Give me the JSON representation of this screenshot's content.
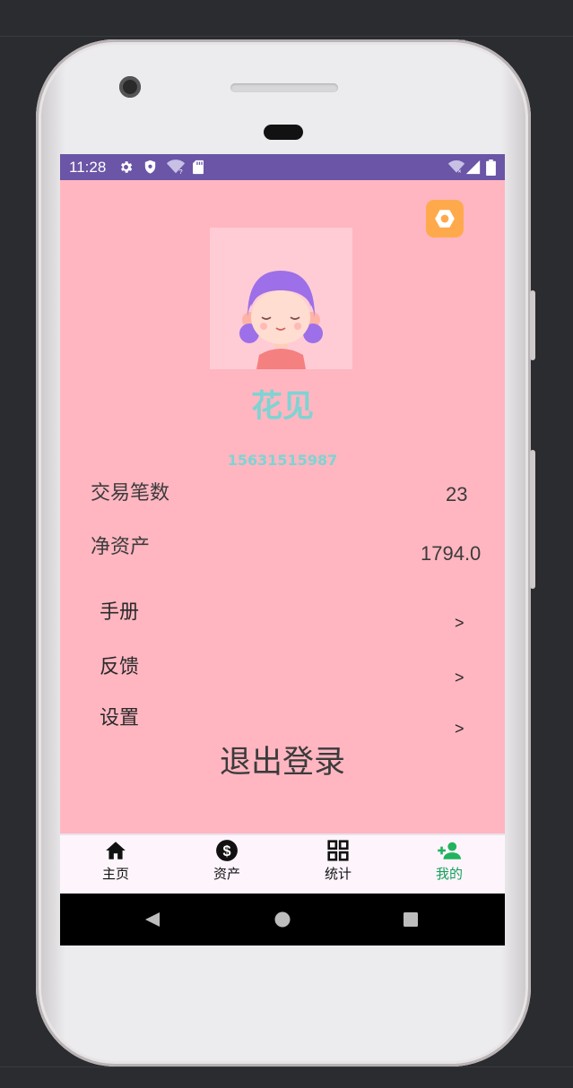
{
  "status_bar": {
    "time": "11:28",
    "color": "#6a55a6",
    "left_icons": [
      "gear-icon",
      "shield-icon",
      "wifi-question-icon",
      "sd-card-icon"
    ],
    "right_icons": [
      "wifi-off-icon",
      "signal-icon",
      "battery-icon"
    ]
  },
  "profile": {
    "name": "花见",
    "phone": "15631515987",
    "name_color": "#7fd3d3",
    "avatar": "girl-avatar-icon"
  },
  "stats": [
    {
      "label": "交易笔数",
      "value": "23"
    },
    {
      "label": "净资产",
      "value": "1794.0"
    }
  ],
  "menu": [
    {
      "label": "手册",
      "arrow": ">"
    },
    {
      "label": "反馈",
      "arrow": ">"
    },
    {
      "label": "设置",
      "arrow": ">"
    }
  ],
  "logout_label": "退出登录",
  "tabs": [
    {
      "label": "主页",
      "icon": "home-icon"
    },
    {
      "label": "资产",
      "icon": "dollar-circle-icon"
    },
    {
      "label": "统计",
      "icon": "grid-icon"
    },
    {
      "label": "我的",
      "icon": "person-add-icon",
      "active": true
    }
  ],
  "colors": {
    "page_background": "#ffb6c1",
    "accent_active": "#15a05c",
    "settings_button": "#ffa94d"
  }
}
